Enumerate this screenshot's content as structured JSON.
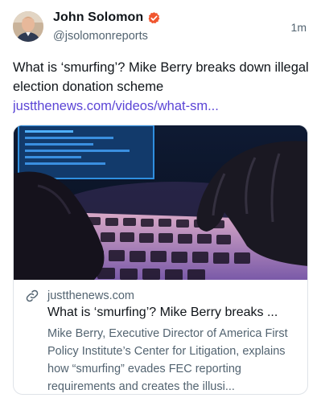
{
  "post": {
    "author": {
      "name": "John Solomon",
      "handle": "@jsolomonreports",
      "verified": true
    },
    "timestamp": "1m",
    "text": "What is ‘smurfing’? Mike Berry breaks down illegal election donation scheme",
    "link_text": "justthenews.com/videos/what-sm..."
  },
  "card": {
    "domain": "justthenews.com",
    "title": "What is ‘smurfing’? Mike Berry breaks ...",
    "description": "Mike Berry, Executive Director of America First Policy Institute’s Center for Litigation, explains how “smurfing” evades FEC reporting requirements and creates the illusi...",
    "image": "hacker-gloved-hands-on-keyboard"
  },
  "colors": {
    "accent_link": "#5b45d6",
    "verified_badge": "#f0562f",
    "secondary_text": "#536471",
    "card_border": "#dfe3e8"
  }
}
